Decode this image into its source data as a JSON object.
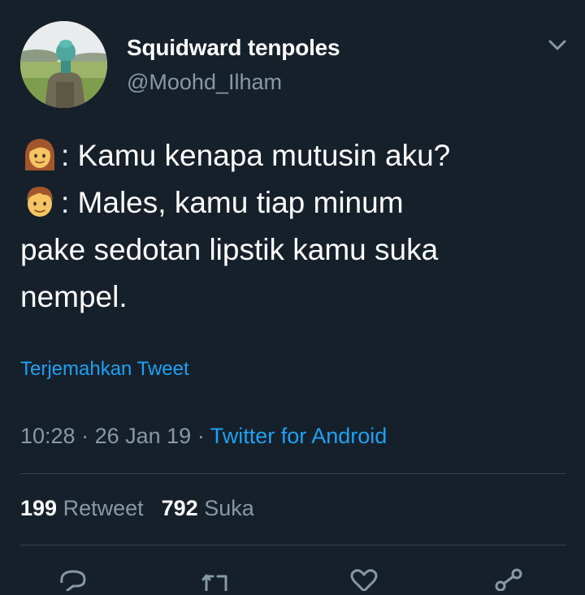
{
  "user": {
    "display_name": "Squidward tenpoles",
    "handle": "@Moohd_Ilham"
  },
  "tweet": {
    "lines": [
      {
        "emoji": "woman-emoji",
        "text": ": Kamu kenapa mutusin aku?"
      },
      {
        "emoji": "boy-emoji",
        "text": ": Males, kamu tiap minum"
      },
      {
        "text": "pake sedotan lipstik kamu suka"
      },
      {
        "text": "nempel."
      }
    ],
    "translate_label": "Terjemahkan Tweet",
    "time": "10:28",
    "date": "26 Jan 19",
    "separator": " · ",
    "source": "Twitter for Android"
  },
  "stats": {
    "retweets": "199",
    "retweets_label": "Retweet",
    "likes": "792",
    "likes_label": "Suka"
  },
  "actions": [
    "reply-icon",
    "retweet-icon",
    "like-icon",
    "share-icon"
  ],
  "colors": {
    "background": "#15202b",
    "text": "#ffffff",
    "secondary": "#8899a6",
    "accent": "#1da1f2",
    "divider": "#38444d"
  }
}
